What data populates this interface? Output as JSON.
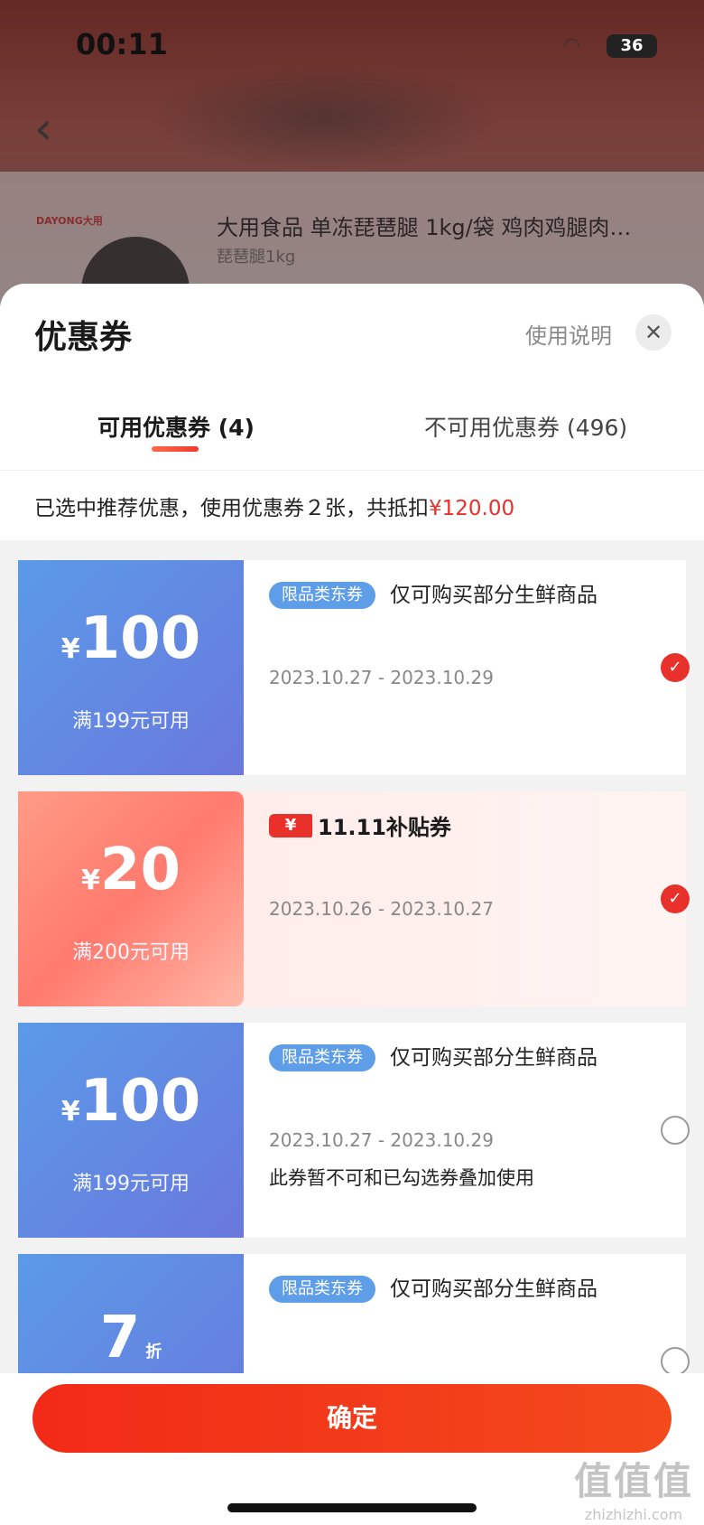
{
  "status": {
    "time": "00:11",
    "battery": "36"
  },
  "background": {
    "product_title": "大用食品 单冻琵琶腿 1kg/袋 鸡肉鸡腿肉…",
    "product_spec": "琵琶腿1kg",
    "brand_logo": "DAYONG大用"
  },
  "sheet": {
    "title": "优惠券",
    "help_label": "使用说明",
    "close_icon": "close-icon"
  },
  "tabs": [
    {
      "label": "可用优惠券 (4)",
      "active": true
    },
    {
      "label": "不可用优惠券 (496)",
      "active": false
    }
  ],
  "summary": {
    "text": "已选中推荐优惠，使用优惠券２张，共抵扣",
    "amount": "¥120.00"
  },
  "coupons": [
    {
      "yen": "¥",
      "amount": "100",
      "condition": "满199元可用",
      "tag": "限品类东券",
      "desc": "仅可购买部分生鲜商品",
      "date": "2023.10.27 - 2023.10.29",
      "selected": true
    },
    {
      "yen": "¥",
      "amount": "20",
      "condition": "满200元可用",
      "badge_yen": "¥",
      "badge_text": "11.11补贴券",
      "date": "2023.10.26 - 2023.10.27",
      "selected": true
    },
    {
      "yen": "¥",
      "amount": "100",
      "condition": "满199元可用",
      "tag": "限品类东券",
      "desc": "仅可购买部分生鲜商品",
      "date": "2023.10.27 - 2023.10.29",
      "note": "此券暂不可和已勾选券叠加使用",
      "selected": false
    },
    {
      "amount": "7",
      "unit": "折",
      "tag": "限品类东券",
      "desc": "仅可购买部分生鲜商品",
      "selected": false
    }
  ],
  "confirm": {
    "label": "确定"
  },
  "watermark": {
    "logo": "值值值",
    "url": "zhizhizhi.com"
  },
  "colors": {
    "accent": "#e8312a",
    "coupon_blue": "#5e9de8"
  }
}
